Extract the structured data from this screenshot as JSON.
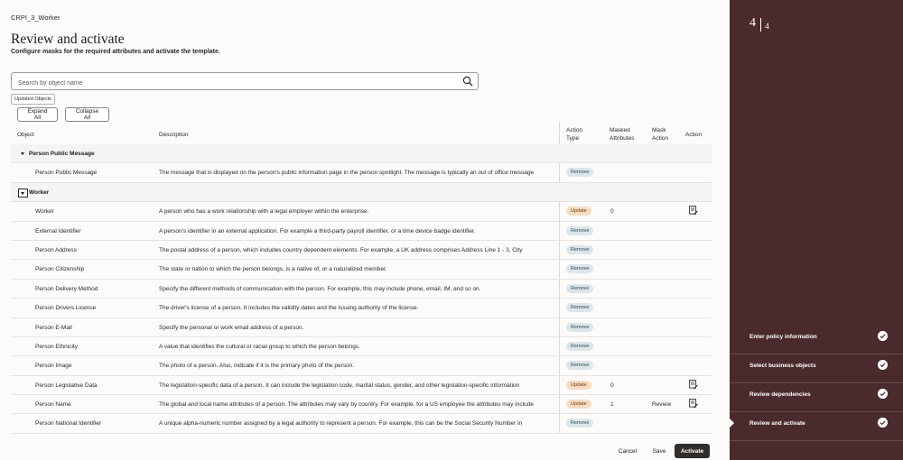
{
  "breadcrumb": "CRPI_3_Worker",
  "page_title": "Review and activate",
  "subtitle": "Configure masks for the required attributes and activate the template.",
  "search": {
    "placeholder": "Search by object name"
  },
  "filter_chip": "Updated Objects",
  "buttons": {
    "expand_all": "Expand All",
    "collapse_all": "Collapse All",
    "cancel": "Cancel",
    "save": "Save",
    "activate": "Activate"
  },
  "columns": {
    "object": "Object",
    "description": "Description",
    "action_type_1": "Action",
    "action_type_2": "Type",
    "masked_1": "Masked",
    "masked_2": "Attributes",
    "mask_action_1": "Mask",
    "mask_action_2": "Action",
    "action": "Action"
  },
  "groups": {
    "public_message": "Person Public Message",
    "worker": "Worker"
  },
  "rows": [
    {
      "object": "Person Public Message",
      "description": "The message that is displayed on the person's public information page in the person spotlight. The message is typically an out of office message",
      "action_type": "Remove",
      "masked": "",
      "mask_action": ""
    },
    {
      "object": "Worker",
      "description": "A person who has a work relationship with a legal employer within the enterprise.",
      "action_type": "Update",
      "masked": "0",
      "mask_action": ""
    },
    {
      "object": "External Identifier",
      "description": "A person's identifier in an external application. For example a third-party payroll identifier, or a time device badge identifier.",
      "action_type": "Remove",
      "masked": "",
      "mask_action": ""
    },
    {
      "object": "Person Address",
      "description": "The postal address of a person, which includes country dependent elements. For example, a UK address comprises Address Line 1 - 3, City",
      "action_type": "Remove",
      "masked": "",
      "mask_action": ""
    },
    {
      "object": "Person Citizenship",
      "description": "The state or nation to which the person belongs, is a native of, or a naturalized member.",
      "action_type": "Remove",
      "masked": "",
      "mask_action": ""
    },
    {
      "object": "Person Delivery Method",
      "description": "Specify the different methods of communication with the person. For example, this may include phone, email, IM, and so on.",
      "action_type": "Remove",
      "masked": "",
      "mask_action": ""
    },
    {
      "object": "Person Drivers License",
      "description": "The driver's license of a person. It includes the validity dates and the issuing authority of the license.",
      "action_type": "Remove",
      "masked": "",
      "mask_action": ""
    },
    {
      "object": "Person E-Mail",
      "description": "Specify the personal or work email address of a person.",
      "action_type": "Remove",
      "masked": "",
      "mask_action": ""
    },
    {
      "object": "Person Ethnicity",
      "description": "A value that identifies the cultural or racial group to which the person belongs.",
      "action_type": "Remove",
      "masked": "",
      "mask_action": ""
    },
    {
      "object": "Person Image",
      "description": "The photo of a person. Also, indicate if it is the primary photo of the person.",
      "action_type": "Remove",
      "masked": "",
      "mask_action": ""
    },
    {
      "object": "Person Legislative Data",
      "description": "The legislation-specific data of a person. It can include the legislation code, marital status, gender, and other legislation-specific information",
      "action_type": "Update",
      "masked": "0",
      "mask_action": ""
    },
    {
      "object": "Person Name",
      "description": "The global and local name attributes of a person. The attributes may vary by country. For example, for a US employee the attributes may include",
      "action_type": "Update",
      "masked": "1",
      "mask_action": "Review"
    },
    {
      "object": "Person National Identifier",
      "description": "A unique alpha-numeric number assigned by a legal authority to represent a person. For example, this can be the Social Security Number in",
      "action_type": "Remove",
      "masked": "",
      "mask_action": ""
    }
  ],
  "train": {
    "current": "4",
    "total": "4",
    "steps": [
      "Enter policy information",
      "Select business objects",
      "Review dependencies",
      "Review and activate"
    ]
  },
  "icons": {
    "search": "search-icon",
    "edit_mask": "edit-mask-icon",
    "check": "check-circle-icon"
  },
  "colors": {
    "sidebar": "#4b2a2d",
    "remove_badge": "#dce6ea",
    "update_badge": "#f7dcc3",
    "primary_button": "#312d2a"
  }
}
